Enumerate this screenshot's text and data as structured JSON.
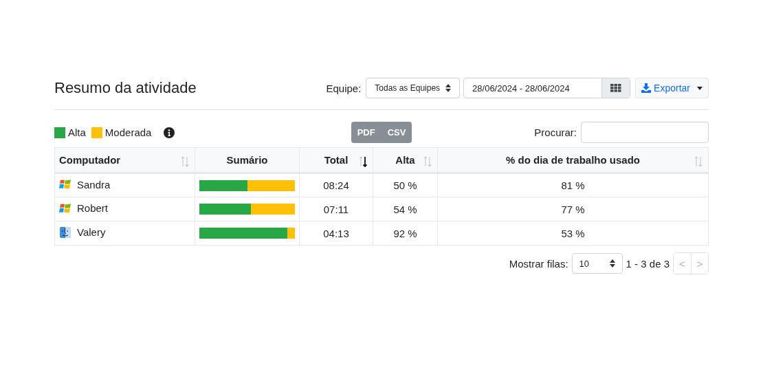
{
  "title": "Resumo da atividade",
  "team_filter": {
    "label": "Equipe:",
    "value": "Todas as Equipes"
  },
  "date_range": {
    "value": "28/06/2024 - 28/06/2024"
  },
  "export_button": {
    "label": "Exportar"
  },
  "legend": [
    {
      "label": "Alta",
      "color": "#28a745"
    },
    {
      "label": "Moderada",
      "color": "#ffc107"
    }
  ],
  "export_formats": [
    "PDF",
    "CSV"
  ],
  "search": {
    "label": "Procurar:"
  },
  "table": {
    "columns": [
      {
        "label": "Computador",
        "sortable": true,
        "sorted": false
      },
      {
        "label": "Sumário",
        "sortable": false
      },
      {
        "label": "Total",
        "sortable": true,
        "sorted": true
      },
      {
        "label": "Alta",
        "sortable": true,
        "sorted": false
      },
      {
        "label": "% do dia de trabalho usado",
        "sortable": true,
        "sorted": false
      }
    ],
    "rows": [
      {
        "kind": "windows",
        "name": "Sandra",
        "level": 0.5,
        "total": "08:24",
        "alta": "50 %",
        "workday": "81 %"
      },
      {
        "kind": "windows",
        "name": "Robert",
        "level": 0.54,
        "total": "07:11",
        "alta": "54 %",
        "workday": "77 %"
      },
      {
        "kind": "mac",
        "name": "Valery",
        "level": 0.92,
        "total": "04:13",
        "alta": "92 %",
        "workday": "53 %"
      }
    ]
  },
  "pagination": {
    "label": "Mostrar filas:",
    "page_size": "10",
    "range": "1 - 3 de 3",
    "prev": {
      "label": "<",
      "disabled": true
    },
    "next": {
      "label": ">",
      "disabled": true
    }
  }
}
